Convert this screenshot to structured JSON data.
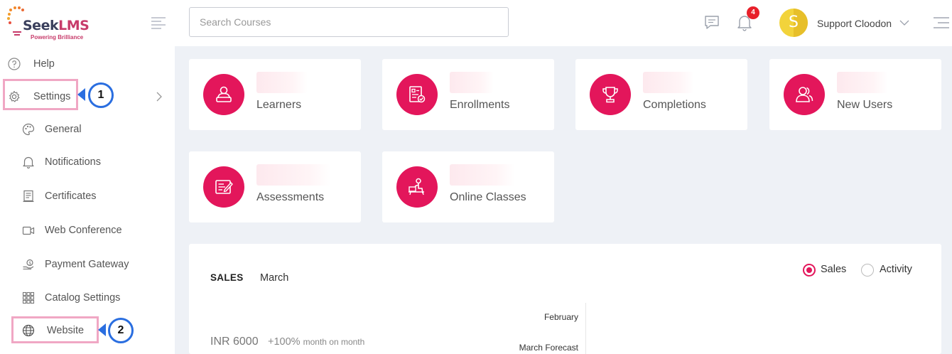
{
  "brand": {
    "name_part1": "Seek",
    "name_part2": "LMS",
    "tagline": "Powering Brilliance"
  },
  "header": {
    "search_placeholder": "Search Courses",
    "notification_count": "4",
    "user_initial": "S",
    "user_name": "Support Cloodon"
  },
  "sidebar": {
    "help": "Help",
    "settings": "Settings",
    "items": [
      {
        "label": "General",
        "icon": "palette-icon"
      },
      {
        "label": "Notifications",
        "icon": "bell-icon"
      },
      {
        "label": "Certificates",
        "icon": "certificate-icon"
      },
      {
        "label": "Web Conference",
        "icon": "video-icon"
      },
      {
        "label": "Payment Gateway",
        "icon": "payment-icon"
      },
      {
        "label": "Catalog Settings",
        "icon": "grid-icon"
      }
    ],
    "website": "Website"
  },
  "callouts": {
    "one": "1",
    "two": "2"
  },
  "stats": [
    {
      "label": "Learners",
      "icon": "learner-icon"
    },
    {
      "label": "Enrollments",
      "icon": "enrollment-icon"
    },
    {
      "label": "Completions",
      "icon": "trophy-icon"
    },
    {
      "label": "New Users",
      "icon": "new-users-icon"
    },
    {
      "label": "Assessments",
      "icon": "assessment-icon"
    },
    {
      "label": "Online Classes",
      "icon": "online-class-icon"
    }
  ],
  "sales": {
    "tab": "SALES",
    "period": "March",
    "radio_sales": "Sales",
    "radio_activity": "Activity",
    "selected": "Sales",
    "amount": "INR 6000",
    "change_value": "+100%",
    "change_suffix": "month on month",
    "legend_1": "February",
    "legend_2": "March Forecast"
  },
  "colors": {
    "accent": "#e3165b",
    "highlight": "#f0a7c4",
    "callout": "#2a6ee0"
  }
}
